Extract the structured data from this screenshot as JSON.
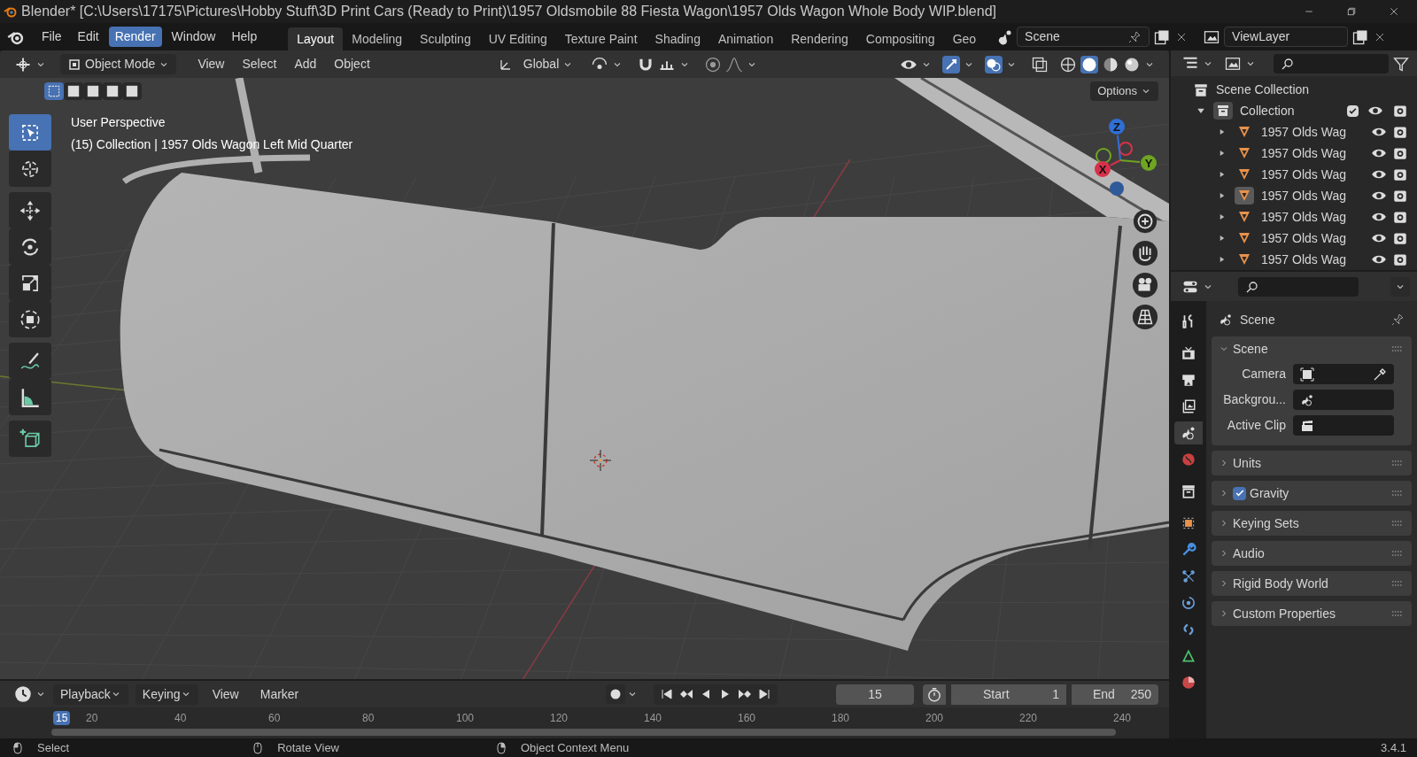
{
  "window": {
    "title": "Blender* [C:\\Users\\17175\\Pictures\\Hobby Stuff\\3D Print Cars (Ready to Print)\\1957 Oldsmobile 88 Fiesta Wagon\\1957 Olds Wagon Whole Body WIP.blend]"
  },
  "menu": [
    {
      "label": "File",
      "selected": false
    },
    {
      "label": "Edit",
      "selected": false
    },
    {
      "label": "Render",
      "selected": true
    },
    {
      "label": "Window",
      "selected": false
    },
    {
      "label": "Help",
      "selected": false
    }
  ],
  "workspaces": [
    {
      "label": "Layout",
      "selected": true
    },
    {
      "label": "Modeling",
      "selected": false
    },
    {
      "label": "Sculpting",
      "selected": false
    },
    {
      "label": "UV Editing",
      "selected": false
    },
    {
      "label": "Texture Paint",
      "selected": false
    },
    {
      "label": "Shading",
      "selected": false
    },
    {
      "label": "Animation",
      "selected": false
    },
    {
      "label": "Rendering",
      "selected": false
    },
    {
      "label": "Compositing",
      "selected": false
    },
    {
      "label": "Geo",
      "selected": false
    }
  ],
  "scene_field": "Scene",
  "view_layer_field": "ViewLayer",
  "viewport": {
    "mode": "Object Mode",
    "menus": [
      "View",
      "Select",
      "Add",
      "Object"
    ],
    "orientation": "Global",
    "options": "Options",
    "select_modes": [
      {
        "selected": true
      },
      {
        "selected": false
      },
      {
        "selected": false
      },
      {
        "selected": false
      },
      {
        "selected": false
      }
    ],
    "overlay_lines": [
      "User Perspective",
      "(15) Collection | 1957 Olds Wagon Left Mid Quarter"
    ],
    "axes": [
      {
        "label": "Z",
        "color": "#2f6fd6"
      },
      {
        "label": "Y",
        "color": "#6ea521"
      },
      {
        "label": "X",
        "color": "#d9304a"
      }
    ],
    "tools": [
      {
        "kind": "select",
        "selected": true
      },
      {
        "kind": "cursor",
        "selected": false
      },
      {
        "kind": "move",
        "selected": false
      },
      {
        "kind": "rotate",
        "selected": false
      },
      {
        "kind": "scale",
        "selected": false
      },
      {
        "kind": "transform",
        "selected": false
      },
      {
        "kind": "annotate",
        "selected": false
      },
      {
        "kind": "measure",
        "selected": false
      },
      {
        "kind": "add_cube",
        "selected": false
      }
    ]
  },
  "outliner": {
    "root": "Scene Collection",
    "collection": {
      "label": "Collection",
      "expanded": true,
      "checked": true,
      "children": [
        {
          "label": "1957 Olds Wag",
          "expanded": false,
          "selected": false
        },
        {
          "label": "1957 Olds Wag",
          "expanded": false,
          "selected": false
        },
        {
          "label": "1957 Olds Wag",
          "expanded": false,
          "selected": false
        },
        {
          "label": "1957 Olds Wag",
          "expanded": false,
          "selected": true
        },
        {
          "label": "1957 Olds Wag",
          "expanded": false,
          "selected": false
        },
        {
          "label": "1957 Olds Wag",
          "expanded": false,
          "selected": false
        },
        {
          "label": "1957 Olds Wag",
          "expanded": false,
          "selected": false
        }
      ]
    }
  },
  "properties": {
    "tabs": [
      {
        "kind": "tool",
        "selected": false
      },
      {
        "kind": "render",
        "selected": false
      },
      {
        "kind": "output",
        "selected": false
      },
      {
        "kind": "view_layer",
        "selected": false
      },
      {
        "kind": "scene",
        "selected": true
      },
      {
        "kind": "world",
        "selected": false
      },
      {
        "kind": "collection",
        "selected": false
      },
      {
        "kind": "object",
        "selected": false
      },
      {
        "kind": "modifier",
        "selected": false
      },
      {
        "kind": "particles",
        "selected": false
      },
      {
        "kind": "physics",
        "selected": false
      },
      {
        "kind": "constraints",
        "selected": false
      },
      {
        "kind": "data",
        "selected": false
      },
      {
        "kind": "material",
        "selected": false
      }
    ],
    "context": "Scene",
    "panels": [
      {
        "label": "Scene",
        "expanded": true,
        "fields": [
          {
            "label": "Camera",
            "kind": "camera"
          },
          {
            "label": "Backgrou...",
            "kind": "scene"
          },
          {
            "label": "Active Clip",
            "kind": "clip"
          }
        ]
      },
      {
        "label": "Units",
        "expanded": false
      },
      {
        "label": "Gravity",
        "expanded": false,
        "checked": true
      },
      {
        "label": "Keying Sets",
        "expanded": false
      },
      {
        "label": "Audio",
        "expanded": false
      },
      {
        "label": "Rigid Body World",
        "expanded": false
      },
      {
        "label": "Custom Properties",
        "expanded": false
      }
    ]
  },
  "timeline": {
    "menus": [
      "Playback",
      "Keying",
      "View",
      "Marker"
    ],
    "current_frame": "15",
    "playhead_frame": "15",
    "start_label": "Start",
    "start": "1",
    "end_label": "End",
    "end": "250",
    "ticks": [
      "20",
      "40",
      "60",
      "80",
      "100",
      "120",
      "140",
      "160",
      "180",
      "200",
      "220",
      "240"
    ]
  },
  "status_bar": {
    "hints": [
      "Select",
      "Rotate View",
      "Object Context Menu"
    ],
    "version": "3.4.1"
  }
}
